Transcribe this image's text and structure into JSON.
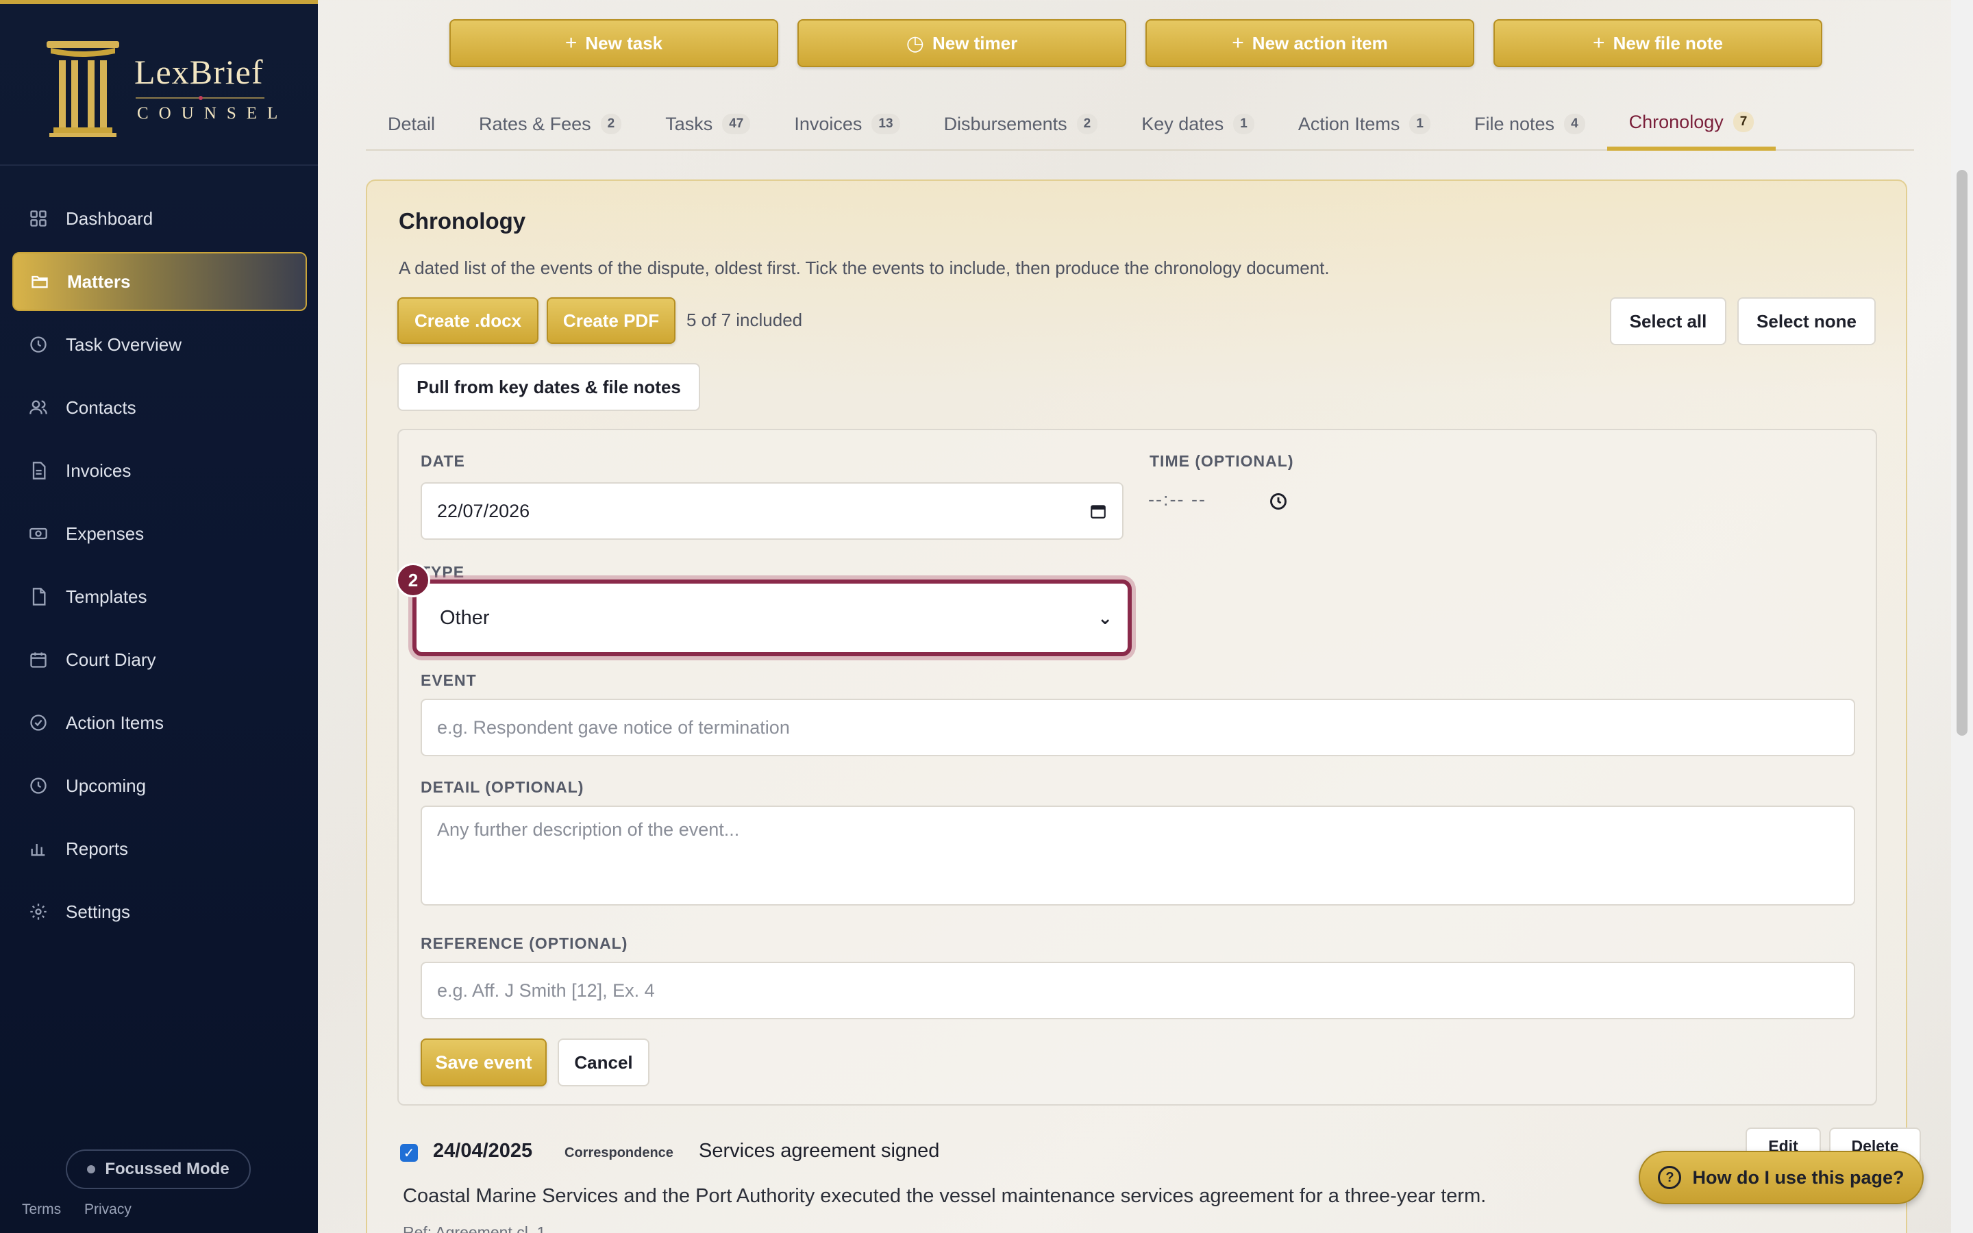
{
  "brand": {
    "name": "LexBrief",
    "sub": "COUNSEL"
  },
  "nav": {
    "items": [
      {
        "label": "Dashboard",
        "icon": "grid-icon"
      },
      {
        "label": "Matters",
        "icon": "folder-icon",
        "active": true
      },
      {
        "label": "Task Overview",
        "icon": "clock-icon"
      },
      {
        "label": "Contacts",
        "icon": "users-icon"
      },
      {
        "label": "Invoices",
        "icon": "document-icon"
      },
      {
        "label": "Expenses",
        "icon": "banknote-icon"
      },
      {
        "label": "Templates",
        "icon": "file-icon"
      },
      {
        "label": "Court Diary",
        "icon": "calendar-icon"
      },
      {
        "label": "Action Items",
        "icon": "check-circle-icon"
      },
      {
        "label": "Upcoming",
        "icon": "clock-icon"
      },
      {
        "label": "Reports",
        "icon": "bar-chart-icon"
      },
      {
        "label": "Settings",
        "icon": "gear-icon"
      }
    ],
    "focus_mode": "Focussed Mode",
    "terms": "Terms",
    "privacy": "Privacy"
  },
  "actions": {
    "new_task": "New task",
    "new_timer": "New timer",
    "new_action_item": "New action item",
    "new_file_note": "New file note"
  },
  "tabs": [
    {
      "label": "Detail",
      "count": ""
    },
    {
      "label": "Rates & Fees",
      "count": "2"
    },
    {
      "label": "Tasks",
      "count": "47"
    },
    {
      "label": "Invoices",
      "count": "13"
    },
    {
      "label": "Disbursements",
      "count": "2"
    },
    {
      "label": "Key dates",
      "count": "1"
    },
    {
      "label": "Action Items",
      "count": "1"
    },
    {
      "label": "File notes",
      "count": "4"
    },
    {
      "label": "Chronology",
      "count": "7",
      "active": true
    }
  ],
  "chronology": {
    "title": "Chronology",
    "description": "A dated list of the events of the dispute, oldest first. Tick the events to include, then produce the chronology document.",
    "create_docx": "Create .docx",
    "create_pdf": "Create PDF",
    "included": "5 of 7 included",
    "select_all": "Select all",
    "select_none": "Select none",
    "pull": "Pull from key dates & file notes"
  },
  "form": {
    "date_label": "DATE",
    "date_value": "22/07/2026",
    "time_label": "TIME (OPTIONAL)",
    "time_value": "--:-- --",
    "type_label": "TYPE",
    "type_value": "Other",
    "step_badge": "2",
    "event_label": "EVENT",
    "event_placeholder": "e.g. Respondent gave notice of termination",
    "detail_label": "DETAIL (OPTIONAL)",
    "detail_placeholder": "Any further description of the event...",
    "reference_label": "REFERENCE (OPTIONAL)",
    "reference_placeholder": "e.g. Aff. J Smith [12], Ex. 4",
    "save": "Save event",
    "cancel": "Cancel"
  },
  "entry": {
    "date": "24/04/2025",
    "type": "Correspondence",
    "title": "Services agreement signed",
    "description": "Coastal Marine Services and the Port Authority executed the vessel maintenance services agreement for a three-year term.",
    "reference": "Ref: Agreement cl. 1",
    "edit": "Edit",
    "delete": "Delete"
  },
  "help": {
    "label": "How do I use this page?"
  },
  "colors": {
    "navy": "#0f1a33",
    "gold": "#cfa733",
    "maroon": "#7a1f3a"
  }
}
